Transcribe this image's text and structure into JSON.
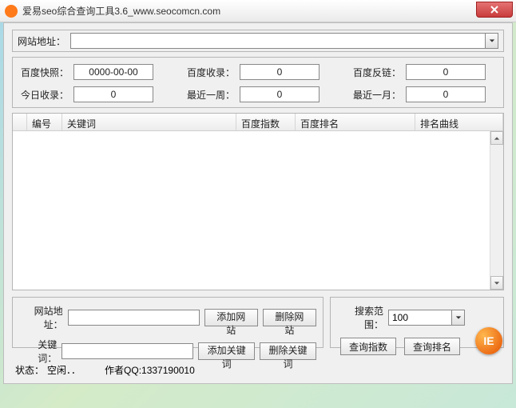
{
  "titlebar": {
    "icon_letter": "●",
    "title": "爱易seo综合查询工具3.6_www.seocomcn.com"
  },
  "url_panel": {
    "label": "网站地址：",
    "value": ""
  },
  "stats": {
    "row1": [
      {
        "label": "百度快照：",
        "value": "0000-00-00"
      },
      {
        "label": "百度收录：",
        "value": "0"
      },
      {
        "label": "百度反链：",
        "value": "0"
      }
    ],
    "row2": [
      {
        "label": "今日收录：",
        "value": "0"
      },
      {
        "label": "最近一周：",
        "value": "0"
      },
      {
        "label": "最近一月：",
        "value": "0"
      }
    ]
  },
  "table": {
    "columns": [
      "编号",
      "关键词",
      "百度指数",
      "百度排名",
      "排名曲线"
    ],
    "rows": []
  },
  "bottom_left": {
    "url_label": "网站地址：",
    "url_value": "",
    "kw_label": "关键词：",
    "kw_value": "",
    "btn_add_site": "添加网站",
    "btn_del_site": "删除网站",
    "btn_add_kw": "添加关键词",
    "btn_del_kw": "删除关键词"
  },
  "bottom_right": {
    "range_label": "搜索范围：",
    "range_value": "100",
    "btn_query_index": "查询指数",
    "btn_query_rank": "查询排名"
  },
  "ie_badge": "IE",
  "status": {
    "label": "状态：",
    "value": "空闲．．",
    "author": "作者QQ:1337190010"
  }
}
